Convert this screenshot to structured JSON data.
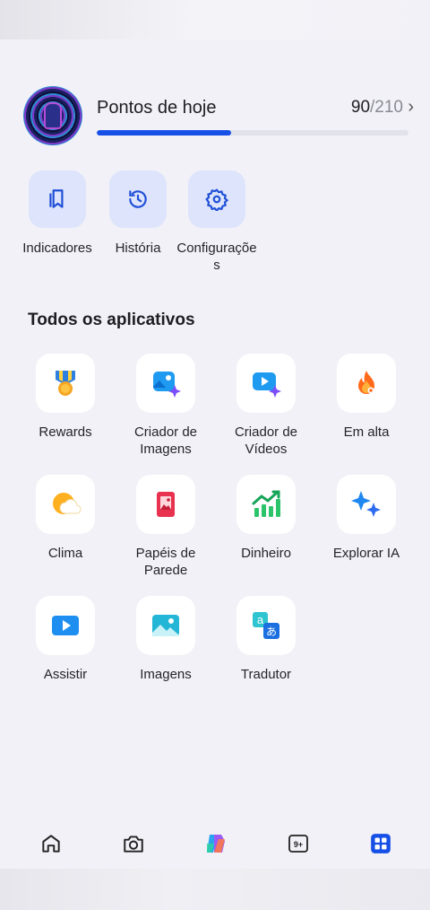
{
  "points": {
    "title": "Pontos de hoje",
    "current": "90",
    "separator": "/",
    "max": "210",
    "progress_fraction": 0.43,
    "chevron": "›"
  },
  "quick_actions": [
    {
      "label": "Indicadores",
      "icon": "bookmark-icon"
    },
    {
      "label": "História",
      "icon": "history-icon"
    },
    {
      "label": "Configuraçõe\ns",
      "icon": "gear-icon"
    }
  ],
  "section_title": "Todos os aplicativos",
  "apps": [
    {
      "label": "Rewards",
      "icon": "medal-icon"
    },
    {
      "label": "Criador de\nImagens",
      "icon": "image-creator-icon"
    },
    {
      "label": "Criador de\nVídeos",
      "icon": "video-creator-icon"
    },
    {
      "label": "Em alta",
      "icon": "flame-icon"
    },
    {
      "label": "Clima",
      "icon": "weather-icon"
    },
    {
      "label": "Papéis de\nParede",
      "icon": "wallpaper-icon"
    },
    {
      "label": "Dinheiro",
      "icon": "money-chart-icon"
    },
    {
      "label": "Explorar IA",
      "icon": "sparkle-icon"
    },
    {
      "label": "Assistir",
      "icon": "play-icon"
    },
    {
      "label": "Imagens",
      "icon": "images-icon"
    },
    {
      "label": "Tradutor",
      "icon": "translator-icon"
    }
  ],
  "bottom_nav": [
    {
      "icon": "home-icon"
    },
    {
      "icon": "camera-icon"
    },
    {
      "icon": "copilot-icon"
    },
    {
      "icon": "tabs-icon",
      "badge": "9+"
    },
    {
      "icon": "apps-grid-icon"
    }
  ],
  "colors": {
    "accent": "#1650e6",
    "tile_bg": "#dde4fb",
    "background": "#f1f1f7"
  }
}
